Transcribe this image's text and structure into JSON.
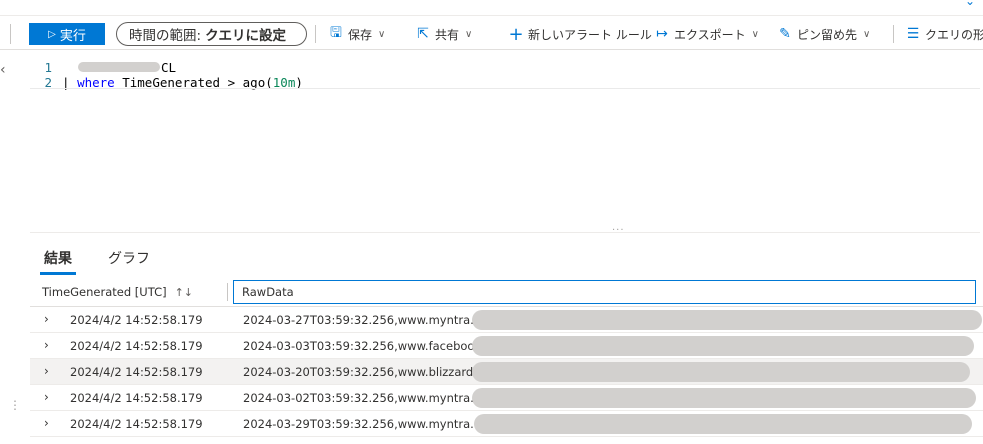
{
  "toolbar": {
    "run_label": "実行",
    "time_range_prefix": "時間の範囲:",
    "time_range_value": "クエリに設定",
    "save_label": "保存",
    "share_label": "共有",
    "new_alert_label": "新しいアラート ルール",
    "export_label": "エクスポート",
    "pin_label": "ピン留め先",
    "format_label": "クエリの形"
  },
  "icons": {
    "run": "play-icon",
    "save": "save-icon",
    "share": "share-icon",
    "new_alert": "plus-icon",
    "export": "export-arrow-icon",
    "pin": "pin-icon",
    "format": "format-icon"
  },
  "editor": {
    "lines": [
      {
        "number": "1",
        "text": "CL"
      },
      {
        "number": "2",
        "pipe": "| ",
        "keyword": "where",
        "field": "TimeGenerated",
        "op": " > ",
        "func": "ago(",
        "arg": "10m",
        "close": ")"
      }
    ]
  },
  "results": {
    "tabs": [
      {
        "label": "結果",
        "active": true
      },
      {
        "label": "グラフ",
        "active": false
      }
    ],
    "columns": {
      "time": "TimeGenerated [UTC]",
      "time_sort": "↑↓",
      "raw": "RawData"
    },
    "rows": [
      {
        "time": "2024/4/2 14:52:58.179",
        "raw": "2024-03-27T03:59:32.256,www.myntra.com,"
      },
      {
        "time": "2024/4/2 14:52:58.179",
        "raw": "2024-03-03T03:59:32.256,www.facebook.co"
      },
      {
        "time": "2024/4/2 14:52:58.179",
        "raw": "2024-03-20T03:59:32.256,www.blizzard.com"
      },
      {
        "time": "2024/4/2 14:52:58.179",
        "raw": "2024-03-02T03:59:32.256,www.myntra.com"
      },
      {
        "time": "2024/4/2 14:52:58.179",
        "raw": "2024-03-29T03:59:32.256,www.myntra.com,"
      }
    ]
  },
  "colors": {
    "accent": "#0078d4",
    "redaction": "#d2d0ce"
  }
}
